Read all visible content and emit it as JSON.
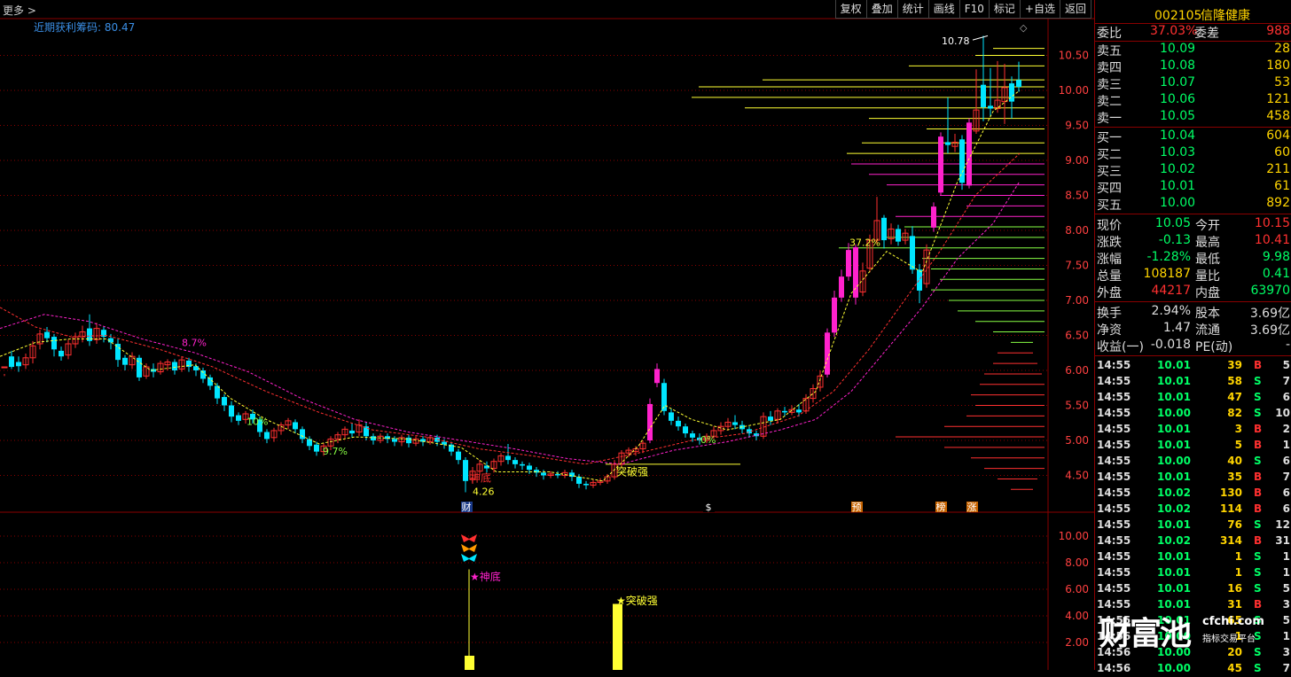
{
  "toolbar": {
    "more_label": "更多",
    "buttons": [
      "复权",
      "叠加",
      "统计",
      "画线",
      "F10",
      "标记",
      "+自选",
      "返回"
    ]
  },
  "indicator": {
    "name": "近期获利筹码",
    "value": "80.47"
  },
  "price_axis": [
    "10.50",
    "10.00",
    "9.50",
    "9.00",
    "8.50",
    "8.00",
    "7.50",
    "7.00",
    "6.50",
    "6.00",
    "5.50",
    "5.00",
    "4.50"
  ],
  "sub_axis": [
    "10.00",
    "8.00",
    "6.00",
    "4.00",
    "2.00"
  ],
  "annotations": {
    "high": "10.78",
    "low": "4.26",
    "pct1": "8.7%",
    "pct2": "9.7%",
    "pct3": "37.2%",
    "pct4": "0%",
    "pct5": "10%",
    "shendi": "神底",
    "tupo": "突破强",
    "cai": "财",
    "s": "$",
    "yu": "预",
    "bang": "榜",
    "zhang": "涨",
    "sub_shendi": "★神底",
    "sub_tupo": "★突破强"
  },
  "colors": {
    "up": "#ff3030",
    "down": "#00e5ff",
    "magenta": "#ff22cc",
    "yellow": "#ffff33",
    "grid": "#8a0000"
  },
  "quote": {
    "code": "002105",
    "name": "信隆健康",
    "weibi_label": "委比",
    "weibi": "37.03%",
    "weicha_label": "委差",
    "weicha": "988",
    "asks": [
      {
        "label": "卖五",
        "price": "10.09",
        "vol": "28"
      },
      {
        "label": "卖四",
        "price": "10.08",
        "vol": "180"
      },
      {
        "label": "卖三",
        "price": "10.07",
        "vol": "53"
      },
      {
        "label": "卖二",
        "price": "10.06",
        "vol": "121"
      },
      {
        "label": "卖一",
        "price": "10.05",
        "vol": "458"
      }
    ],
    "bids": [
      {
        "label": "买一",
        "price": "10.04",
        "vol": "604"
      },
      {
        "label": "买二",
        "price": "10.03",
        "vol": "60"
      },
      {
        "label": "买三",
        "price": "10.02",
        "vol": "211"
      },
      {
        "label": "买四",
        "price": "10.01",
        "vol": "61"
      },
      {
        "label": "买五",
        "price": "10.00",
        "vol": "892"
      }
    ],
    "stats": [
      {
        "l1": "现价",
        "v1": "10.05",
        "c1": "#00ff66",
        "l2": "今开",
        "v2": "10.15",
        "c2": "#ff3030"
      },
      {
        "l1": "涨跌",
        "v1": "-0.13",
        "c1": "#00ff66",
        "l2": "最高",
        "v2": "10.41",
        "c2": "#ff3030"
      },
      {
        "l1": "涨幅",
        "v1": "-1.28%",
        "c1": "#00ff66",
        "l2": "最低",
        "v2": "9.98",
        "c2": "#00ff66"
      },
      {
        "l1": "总量",
        "v1": "108187",
        "c1": "#ffd400",
        "l2": "量比",
        "v2": "0.41",
        "c2": "#00ff66"
      },
      {
        "l1": "外盘",
        "v1": "44217",
        "c1": "#ff3030",
        "l2": "内盘",
        "v2": "63970",
        "c2": "#00ff66"
      }
    ],
    "stats2": [
      {
        "l1": "换手",
        "v1": "2.94%",
        "l2": "股本",
        "v2": "3.69亿"
      },
      {
        "l1": "净资",
        "v1": "1.47",
        "l2": "流通",
        "v2": "3.69亿"
      },
      {
        "l1": "收益(一)",
        "v1": "-0.018",
        "l2": "PE(动)",
        "v2": "-"
      }
    ],
    "ticks": [
      {
        "t": "14:55",
        "p": "10.01",
        "v": "39",
        "bs": "B",
        "n": "5"
      },
      {
        "t": "14:55",
        "p": "10.01",
        "v": "58",
        "bs": "S",
        "n": "7"
      },
      {
        "t": "14:55",
        "p": "10.01",
        "v": "47",
        "bs": "S",
        "n": "6"
      },
      {
        "t": "14:55",
        "p": "10.00",
        "v": "82",
        "bs": "S",
        "n": "10"
      },
      {
        "t": "14:55",
        "p": "10.01",
        "v": "3",
        "bs": "B",
        "n": "2"
      },
      {
        "t": "14:55",
        "p": "10.01",
        "v": "5",
        "bs": "B",
        "n": "1"
      },
      {
        "t": "14:55",
        "p": "10.00",
        "v": "40",
        "bs": "S",
        "n": "6"
      },
      {
        "t": "14:55",
        "p": "10.01",
        "v": "35",
        "bs": "B",
        "n": "7"
      },
      {
        "t": "14:55",
        "p": "10.02",
        "v": "130",
        "bs": "B",
        "n": "6"
      },
      {
        "t": "14:55",
        "p": "10.02",
        "v": "114",
        "bs": "B",
        "n": "6"
      },
      {
        "t": "14:55",
        "p": "10.01",
        "v": "76",
        "bs": "S",
        "n": "12"
      },
      {
        "t": "14:55",
        "p": "10.02",
        "v": "314",
        "bs": "B",
        "n": "31"
      },
      {
        "t": "14:55",
        "p": "10.01",
        "v": "1",
        "bs": "S",
        "n": "1"
      },
      {
        "t": "14:55",
        "p": "10.01",
        "v": "1",
        "bs": "S",
        "n": "1"
      },
      {
        "t": "14:55",
        "p": "10.01",
        "v": "16",
        "bs": "S",
        "n": "5"
      },
      {
        "t": "14:55",
        "p": "10.01",
        "v": "31",
        "bs": "B",
        "n": "3"
      },
      {
        "t": "14:55",
        "p": "10.01",
        "v": "65",
        "bs": "S",
        "n": "5"
      },
      {
        "t": "14:56",
        "p": "10.00",
        "v": "1",
        "bs": "S",
        "n": "1"
      },
      {
        "t": "14:56",
        "p": "10.00",
        "v": "20",
        "bs": "S",
        "n": "3"
      },
      {
        "t": "14:56",
        "p": "10.00",
        "v": "45",
        "bs": "S",
        "n": "7"
      }
    ]
  },
  "watermark": {
    "big": "财富池",
    "url": "cfchi.com",
    "sub": "指标交易平台"
  }
}
